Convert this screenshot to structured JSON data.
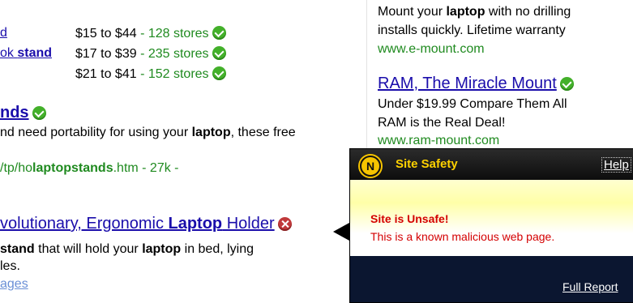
{
  "left": {
    "rows": [
      {
        "link": "d",
        "price": "$15 to $44",
        "stores": "128 stores"
      },
      {
        "link_pre": "ok ",
        "link_bold": "stand",
        "price": "$17 to $39",
        "stores": "235 stores"
      },
      {
        "price": "$21 to $41",
        "stores": "152 stores"
      }
    ],
    "price_sep": " - ",
    "result1": {
      "title": "nds",
      "snip_a": "nd need portability for using your ",
      "snip_b": "laptop",
      "snip_c": ", these free",
      "url_a": "/tp/ho",
      "url_b": "laptopstands",
      "url_c": ".htm - 27k -"
    },
    "result2": {
      "title_a": "volutionary, Ergonomic ",
      "title_b": "Laptop",
      "title_c": " Holder",
      "line1_a": "stand",
      "line1_b": " that will hold your ",
      "line1_c": "laptop",
      "line1_d": " in bed, lying",
      "line2": "les.",
      "line3": "ages"
    }
  },
  "ads": {
    "ad1": {
      "line1_a": "Mount your ",
      "line1_b": "laptop",
      "line1_c": " with no drilling",
      "line2": "installs quickly. Lifetime warranty",
      "url": "www.e-mount.com"
    },
    "ad2": {
      "title": "RAM, The Miracle Mount",
      "line1": "Under $19.99 Compare Them All",
      "line2": "RAM is the Real Deal!",
      "url": "www.ram-mount.com"
    }
  },
  "popup": {
    "logo_letter": "N",
    "title": "Site Safety",
    "help": "Help",
    "status": "Site is Unsafe!",
    "message": "This is a known malicious web page.",
    "footer_link": "Full Report"
  },
  "colors": {
    "link": "#1a0dab",
    "green": "#1f8a1f",
    "unsafe": "#d40000",
    "safe_icon": "#43b02a",
    "unsafe_icon": "#c0393b",
    "popup_header": "#1a1a1a",
    "popup_footer": "#0b1630"
  },
  "icons": {
    "safe": "green-check-icon",
    "unsafe": "red-x-icon",
    "logo": "norton-logo-icon"
  }
}
